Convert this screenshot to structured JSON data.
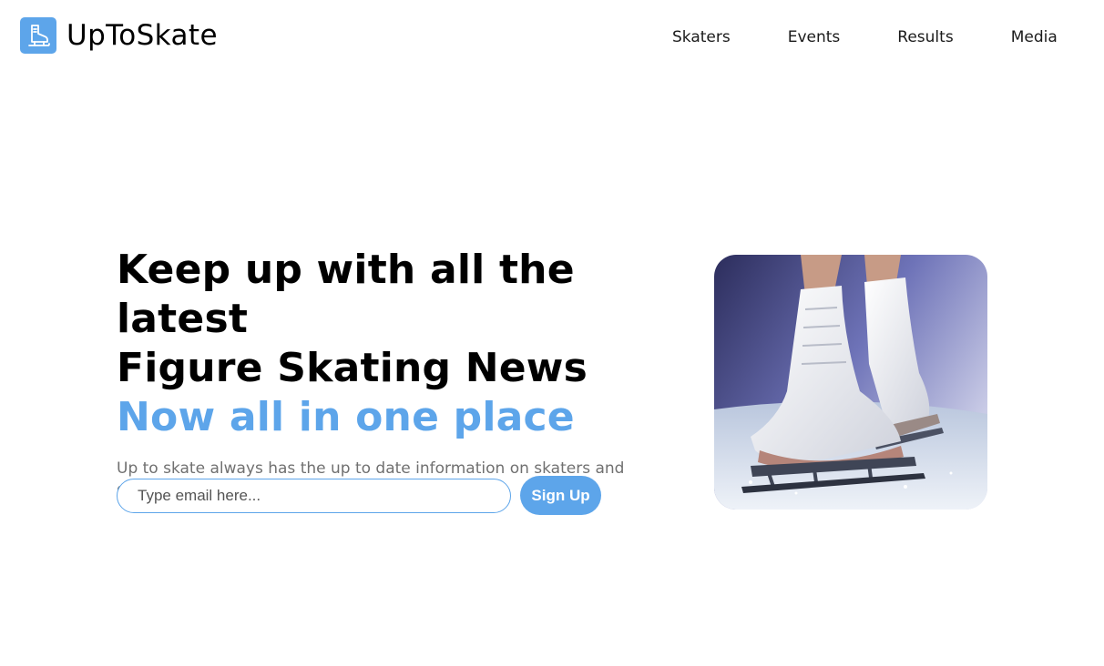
{
  "brand": {
    "name": "UpToSkate",
    "logo_icon": "ice-skate-icon",
    "logo_color": "#5da5ea"
  },
  "nav": {
    "items": [
      {
        "label": "Skaters"
      },
      {
        "label": "Events"
      },
      {
        "label": "Results"
      },
      {
        "label": "Media"
      }
    ]
  },
  "hero": {
    "headline_line1": "Keep up with all the latest",
    "headline_line2": "Figure Skating News",
    "headline_accent": "Now all in one place",
    "subtext": "Up to skate always has the up to date information on skaters and competitions. Sign up for our newsletter.",
    "image": "figure-skates-on-ice-photo"
  },
  "signup": {
    "email_placeholder": "Type email here...",
    "email_value": "",
    "button_label": "Sign Up"
  },
  "colors": {
    "accent": "#5da5ea",
    "text": "#000000",
    "muted": "#707070"
  }
}
